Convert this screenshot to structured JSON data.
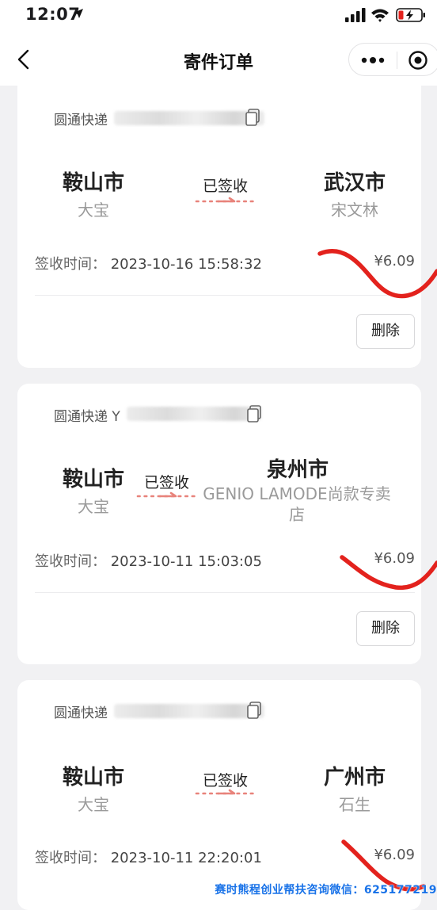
{
  "status_bar": {
    "time": "12:07"
  },
  "nav": {
    "title": "寄件订单"
  },
  "orders": [
    {
      "courier": "圆通快递",
      "tracking_visible": "",
      "from_city": "鞍山市",
      "from_person": "大宝",
      "status": "已签收",
      "to_city": "武汉市",
      "to_person": "宋文林",
      "time_label": "签收时间：",
      "time_value": "2023-10-16 15:58:32",
      "price": "¥6.09",
      "delete_label": "删除"
    },
    {
      "courier": "圆通快递",
      "tracking_visible": "Y",
      "from_city": "鞍山市",
      "from_person": "大宝",
      "status": "已签收",
      "to_city": "泉州市",
      "to_person": "GENIO LAMODE尚款专卖店",
      "time_label": "签收时间：",
      "time_value": "2023-10-11 15:03:05",
      "price": "¥6.09",
      "delete_label": "删除"
    },
    {
      "courier": "圆通快递",
      "tracking_visible": "",
      "from_city": "鞍山市",
      "from_person": "大宝",
      "status": "已签收",
      "to_city": "广州市",
      "to_person": "石生",
      "time_label": "签收时间：",
      "time_value": "2023-10-11 22:20:01",
      "price": "¥6.09",
      "delete_label": "删除"
    }
  ],
  "watermark": "赛时熊程创业帮扶咨询微信：625177219",
  "colors": {
    "accent_arrow": "#e8837b",
    "scribble": "#e3221d",
    "watermark": "#1a73e8"
  }
}
